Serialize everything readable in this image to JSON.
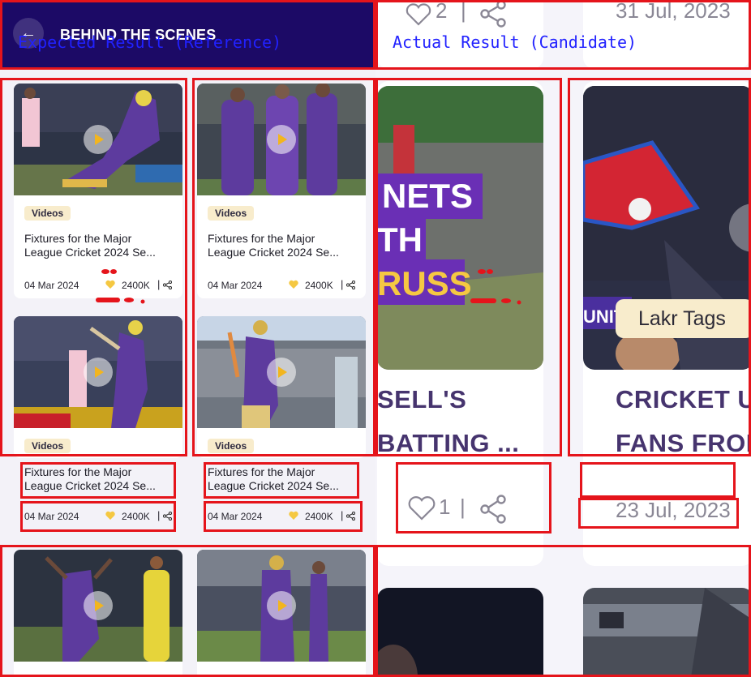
{
  "overlay": {
    "reference_label": "Expected Result (Reference)",
    "candidate_label": "Actual Result (Candidate)"
  },
  "reference": {
    "header": {
      "back_icon": "arrow-left-icon",
      "title": "BEHIND THE SCENES"
    },
    "cards": [
      {
        "badge": "Videos",
        "title_line1": "Fixtures for the Major",
        "title_line2": "League Cricket 2024 Se...",
        "date": "04 Mar 2024",
        "likes": "2400K",
        "sep": "|"
      },
      {
        "badge": "Videos",
        "title_line1": "Fixtures for the Major",
        "title_line2": "League Cricket 2024 Se...",
        "date": "04 Mar 2024",
        "likes": "2400K",
        "sep": "|"
      },
      {
        "badge": "Videos"
      },
      {
        "badge": "Videos"
      },
      {
        "title_line1": "Fixtures for the Major",
        "title_line2": "League Cricket 2024 Se...",
        "date": "04 Mar 2024",
        "likes": "2400K",
        "sep": "|"
      },
      {
        "title_line1": "Fixtures for the Major",
        "title_line2": "League Cricket 2024 Se...",
        "date": "04 Mar 2024",
        "likes": "2400K",
        "sep": "|"
      }
    ]
  },
  "candidate": {
    "top": {
      "likes": "2",
      "sep": "|",
      "date": "31 Jul, 2023"
    },
    "left_card": {
      "overlay_line1": "NETS",
      "overlay_line2": "TH",
      "overlay_line3": "RUSS",
      "title_line1": "SELL'S",
      "title_line2": "BATTING ...",
      "likes": "1",
      "sep": "|"
    },
    "right_card": {
      "tag": "Lakr Tags",
      "banner_text": "UNIT",
      "title_line1": "CRICKET UN",
      "title_line2": "FANS FROM",
      "date": "23 Jul, 2023"
    }
  },
  "colors": {
    "header_bg": "#1c0a66",
    "badge_bg": "#f8eccc",
    "heart": "#f5c842",
    "annotation_red": "#e5141b",
    "label_blue": "#2121ff",
    "candidate_title": "#46346e"
  }
}
